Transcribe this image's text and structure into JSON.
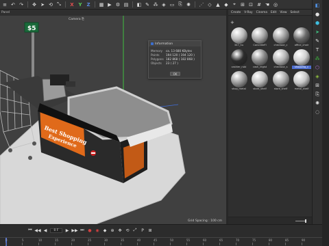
{
  "toolbar": {
    "items": [
      "▣",
      "↶",
      "↷",
      "✚",
      "○",
      "⬭",
      "⚙"
    ],
    "axes": [
      "X",
      "Y",
      "Z"
    ]
  },
  "viewport_header": {
    "menu_label": "Panel"
  },
  "viewport": {
    "camera_label": "Camera",
    "camera_icon": "⎘",
    "grid_spacing": "Grid Spacing : 100 cm",
    "price_sign": "$5",
    "counter_text_line1": "Best Shopping",
    "counter_text_line2": "Experience"
  },
  "info_dialog": {
    "title": "Information",
    "rows": [
      {
        "key": "Memory",
        "value": "ca. 13 680 KBytes"
      },
      {
        "key": "Points",
        "value": "194 120 ( 194 120 )"
      },
      {
        "key": "Polygons",
        "value": "182 868 ( 182 868 )"
      },
      {
        "key": "Objects",
        "value": "23 ( 27 )"
      }
    ],
    "ok_label": "OK"
  },
  "material_browser": {
    "menu": [
      "Create",
      "V-Ray",
      "Cinema",
      "Edit",
      "View",
      "Select"
    ],
    "add_label": "+",
    "materials": [
      {
        "label": "347_hu",
        "color": "#b9b9b9",
        "selected": false
      },
      {
        "label": "ConcreteFl",
        "color": "#a7a7a7",
        "selected": false
      },
      {
        "label": "checkout_c",
        "color": "#9c9c9c",
        "selected": false
      },
      {
        "label": "office_chair",
        "color": "#6a6a6a",
        "selected": false
      },
      {
        "label": "cashier_rubi",
        "color": "#2c2c2c",
        "selected": false
      },
      {
        "label": "cash_regist",
        "color": "#8a8a8a",
        "selected": false
      },
      {
        "label": "checkout_s",
        "color": "#b5b5b5",
        "selected": false
      },
      {
        "label": "shopping_c",
        "color": "#cfcfcf",
        "selected": true
      },
      {
        "label": "shop_metal",
        "color": "#9a9a9a",
        "selected": false
      },
      {
        "label": "store_shelf",
        "color": "#bdbdbd",
        "selected": false
      },
      {
        "label": "store_shelf",
        "color": "#a9a9a9",
        "selected": false
      },
      {
        "label": "metal_shelf",
        "color": "#c7c7c7",
        "selected": false
      }
    ]
  },
  "right_icons": [
    "cube-icon",
    "sphere-icon",
    "cube-plus-icon",
    "arrow-icon",
    "spline-icon",
    "text-icon",
    "cloner-icon",
    "tag-icon",
    "deformer-icon",
    "scene-icon",
    "camera-icon",
    "light-icon",
    "environment-icon"
  ],
  "timeline": {
    "frame_current": "0 F",
    "frame_display": "0 F",
    "ticks": [
      "0",
      "5",
      "10",
      "15",
      "20",
      "25",
      "30",
      "35",
      "40",
      "45",
      "50",
      "55",
      "60",
      "65",
      "70",
      "75",
      "80",
      "85",
      "90"
    ]
  },
  "colors": {
    "accent": "#4f6fd0",
    "counter_orange": "#e06a1a",
    "axis_x": "#e05050",
    "axis_y": "#5ad05a",
    "axis_z": "#5a8ae0"
  }
}
